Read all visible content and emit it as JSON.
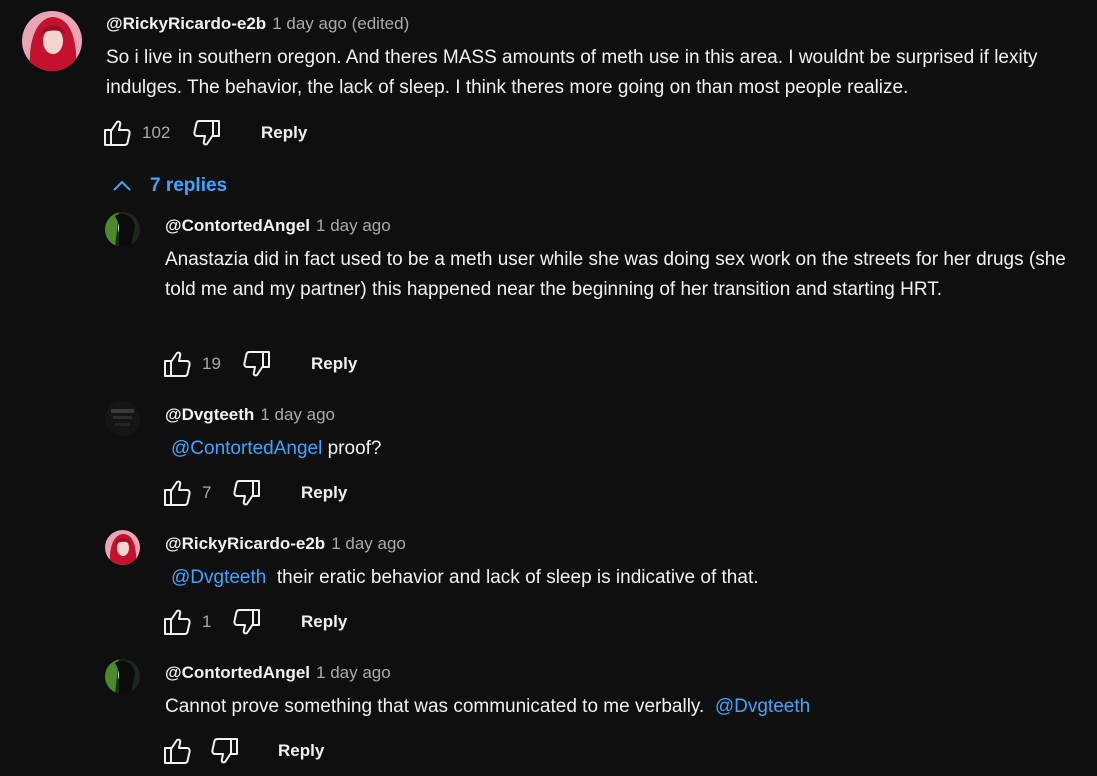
{
  "thread": {
    "top": {
      "author": "@RickyRicardo-e2b",
      "time": "1 day ago (edited)",
      "text": "So i live in southern oregon. And theres MASS amounts of meth use in this area. I wouldnt be surprised if lexity indulges. The behavior, the lack of sleep. I think theres more going on than most people realize.",
      "likes": "102",
      "reply_label": "Reply"
    },
    "replies_toggle": "7 replies",
    "replies": [
      {
        "author": "@ContortedAngel",
        "time": "1 day ago",
        "text": "Anastazia did in fact used to be a meth user while she was doing sex work on the streets for her drugs (she told me and my partner) this happened near the beginning of her transition and starting HRT.",
        "likes": "19",
        "reply_label": "Reply"
      },
      {
        "author": "@Dvgteeth",
        "time": "1 day ago",
        "mention": "@ContortedAngel",
        "text": " proof?",
        "likes": "7",
        "reply_label": "Reply"
      },
      {
        "author": "@RickyRicardo-e2b",
        "time": "1 day ago",
        "mention": "@Dvgteeth",
        "text": "  their eratic behavior and lack of sleep is indicative of that.",
        "likes": "1",
        "reply_label": "Reply"
      },
      {
        "author": "@ContortedAngel",
        "time": "1 day ago",
        "text": "Cannot prove something that was communicated to me verbally.  ",
        "mention": "@Dvgteeth",
        "likes": "",
        "reply_label": "Reply"
      }
    ]
  },
  "colors": {
    "background": "#0f0f0f",
    "text": "#f1f1f1",
    "secondary": "#aaaaaa",
    "link": "#3ea6ff"
  }
}
